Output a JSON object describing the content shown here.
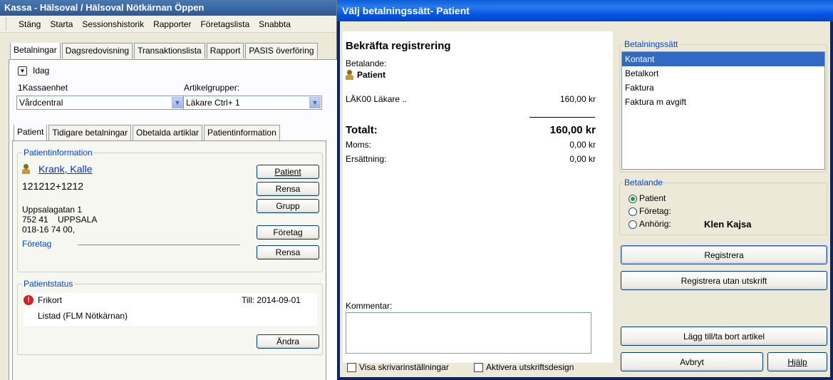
{
  "bg_window": {
    "title": "Kassa - Hälsoval / Hälsoval Nötkärnan Öppen",
    "menu": [
      "Stäng",
      "Starta",
      "Sessionshistorik",
      "Rapporter",
      "Företagslista",
      "Snabbta"
    ],
    "tabs": [
      "Betalningar",
      "Dagsredovisning",
      "Transaktionslista",
      "Rapport",
      "PASIS överföring"
    ],
    "idag_label": "Idag",
    "kassaenhet_label": "1Kassaenhet",
    "kassaenhet_value": "Vårdcentral",
    "artikelgrupper_label": "Artikelgrupper:",
    "artikelgrupper_value": "Läkare Ctrl+ 1",
    "subtabs": [
      "Patient",
      "Tidigare betalningar",
      "Obetalda artiklar",
      "Patientinformation"
    ],
    "patientinfo": {
      "title": "Patientinformation",
      "name": "Krank, Kalle",
      "pnr": "121212+1212",
      "address1": "Uppsalagatan 1",
      "postal_code": "752 41",
      "city": "UPPSALA",
      "phone": "018-16 74 00,",
      "company_label": "Företag",
      "buttons": {
        "patient": "Patient",
        "rensa1": "Rensa",
        "grupp": "Grupp",
        "foretag": "Företag",
        "rensa2": "Rensa"
      }
    },
    "patientstatus": {
      "title": "Patientstatus",
      "status1": "Frikort",
      "till": "Till: 2014-09-01",
      "status2": "Listad (FLM Nötkärnan)",
      "andra_button": "Ändra"
    }
  },
  "dialog": {
    "title": "Välj betalningssätt- Patient",
    "receipt": {
      "heading": "Bekräfta registrering",
      "betalande_label": "Betalande:",
      "betalande_value": "Patient",
      "article_name": "LÄK00 Läkare ..",
      "article_price": "160,00 kr",
      "total_label": "Totalt:",
      "total_value": "160,00 kr",
      "moms_label": "Moms:",
      "moms_value": "0,00 kr",
      "ersattning_label": "Ersättning:",
      "ersattning_value": "0,00 kr"
    },
    "kommentar_label": "Kommentar:",
    "kommentar_value": "",
    "visa_checkbox": "Visa skrivarinställningar",
    "aktivera_checkbox": "Aktivera utskriftsdesign",
    "betalningssatt": {
      "title": "Betalningssätt",
      "options": [
        "Kontant",
        "Betalkort",
        "Faktura",
        "Faktura m avgift"
      ],
      "selected": "Kontant"
    },
    "betalande": {
      "title": "Betalande",
      "options": [
        "Patient",
        "Företag:",
        "Anhörig:"
      ],
      "selected": "Patient",
      "anhorig_name": "Klen Kajsa"
    },
    "buttons": {
      "registrera": "Registrera",
      "registrera_utan": "Registrera utan utskrift",
      "lagg_till": "Lägg till/ta bort artikel",
      "avbryt": "Avbryt",
      "hjalp": "Hjälp"
    }
  }
}
